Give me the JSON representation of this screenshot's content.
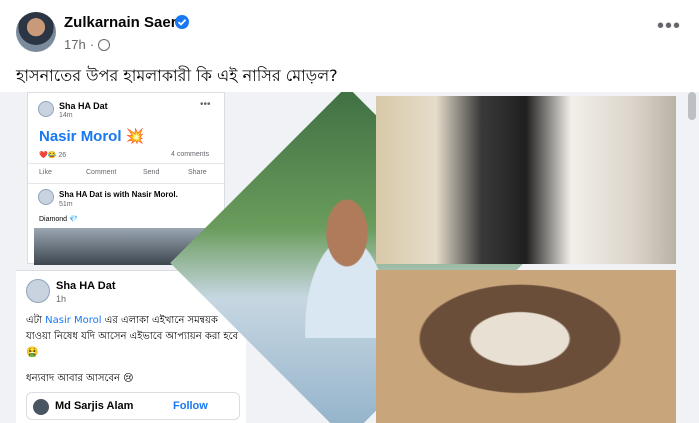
{
  "post": {
    "author": "Zulkarnain Saer",
    "time": "17h",
    "dot": "·",
    "caption": "হাসনাতের উপর হামলাকারী কি এই নাসির মোড়ল?",
    "more": "•••"
  },
  "screenshot_top": {
    "name": "Sha HA Dat",
    "time": "14m",
    "title": "Nasir Morol 💥",
    "reactions": "26",
    "comments": "4 comments",
    "actions": [
      "Like",
      "Comment",
      "Send",
      "Share"
    ],
    "name2": "Sha HA Dat is with Nasir Morol.",
    "time2": "51m",
    "diamond": "Diamond 💎"
  },
  "screenshot_bottom": {
    "name": "Sha HA Dat",
    "time": "1h",
    "text_pre": "এটা ",
    "text_link": "Nasir Morol",
    "text_post": " এর এলাকা এইখানে সমন্বয়ক যাওয়া নিষেধ যদি আসেন এইভাবে আপ্যায়ন করা হবে 🤮",
    "thanks": "ধন্যবাদ আবার আসবেন 😢",
    "reply_name": "Md Sarjis Alam",
    "follow": "Follow"
  },
  "colors": {
    "link": "#1877f2",
    "meta": "#65676b"
  },
  "icons": [
    "verified-badge-icon",
    "globe-icon",
    "more-options-icon"
  ]
}
